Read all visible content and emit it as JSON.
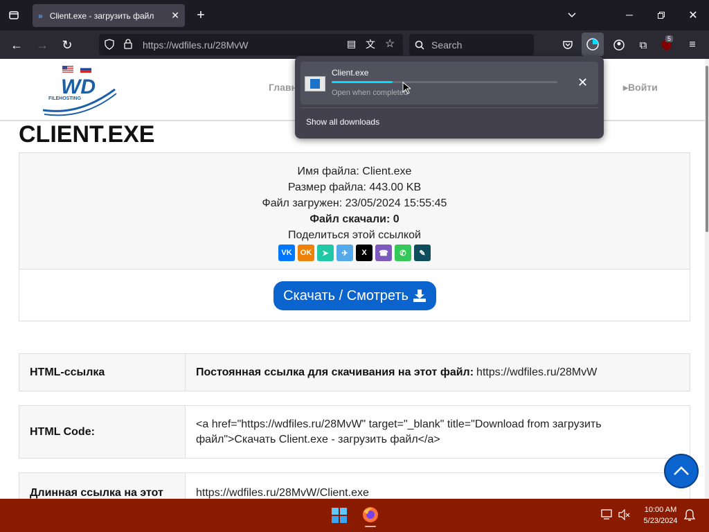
{
  "browser": {
    "tab_title": "Client.exe - загрузить файл",
    "url": "https://wdfiles.ru/28MvW",
    "search_placeholder": "Search",
    "extension_badge": "5"
  },
  "header": {
    "nav_main": "Главн",
    "nav_login": "▸Войти",
    "logo_text": "WD",
    "logo_sub": "FILEHOSTING"
  },
  "page": {
    "title": "CLIENT.EXE",
    "info": {
      "filename": "Имя файла: Client.exe",
      "filesize": "Размер файла: 443.00 KB",
      "uploaded": "Файл загружен: 23/05/2024 15:55:45",
      "downloads": "Файл скачали: 0",
      "share": "Поделиться этой ссылкой"
    },
    "share_icons": [
      {
        "name": "vk-share-icon",
        "label": "VK",
        "color": "#0077ff"
      },
      {
        "name": "ok-share-icon",
        "label": "OK",
        "color": "#ee8208"
      },
      {
        "name": "send-share-icon",
        "label": "➤",
        "color": "#21c8a5"
      },
      {
        "name": "telegram-share-icon",
        "label": "✈",
        "color": "#54a9eb"
      },
      {
        "name": "x-share-icon",
        "label": "X",
        "color": "#000000"
      },
      {
        "name": "viber-share-icon",
        "label": "☎",
        "color": "#7d5bbe"
      },
      {
        "name": "whatsapp-share-icon",
        "label": "✆",
        "color": "#34c759"
      },
      {
        "name": "livejournal-share-icon",
        "label": "✎",
        "color": "#0f4c5c"
      }
    ],
    "download_button": "Скачать / Смотреть",
    "rows": [
      {
        "label": "HTML-ссылка",
        "bold_prefix": "Постоянная ссылка для скачивания на этот файл:",
        "value": "https://wdfiles.ru/28MvW"
      },
      {
        "label": "HTML Code:",
        "bold_prefix": "",
        "value": "<a href=\"https://wdfiles.ru/28MvW\" target=\"_blank\" title=\"Download from загрузить файл\">Скачать Client.exe - загрузить файл</a>"
      },
      {
        "label": "Длинная ссылка на этот",
        "bold_prefix": "",
        "value": "https://wdfiles.ru/28MvW/Client.exe"
      }
    ]
  },
  "downloads_panel": {
    "file_name": "Client.exe",
    "status": "Open when completed",
    "progress": 0.27,
    "show_all": "Show all downloads"
  },
  "taskbar": {
    "time": "10:00 AM",
    "date": "5/23/2024"
  },
  "colors": {
    "accent": "#0b63ce",
    "taskbar": "#8b1b00",
    "progress": "#00ddff"
  }
}
